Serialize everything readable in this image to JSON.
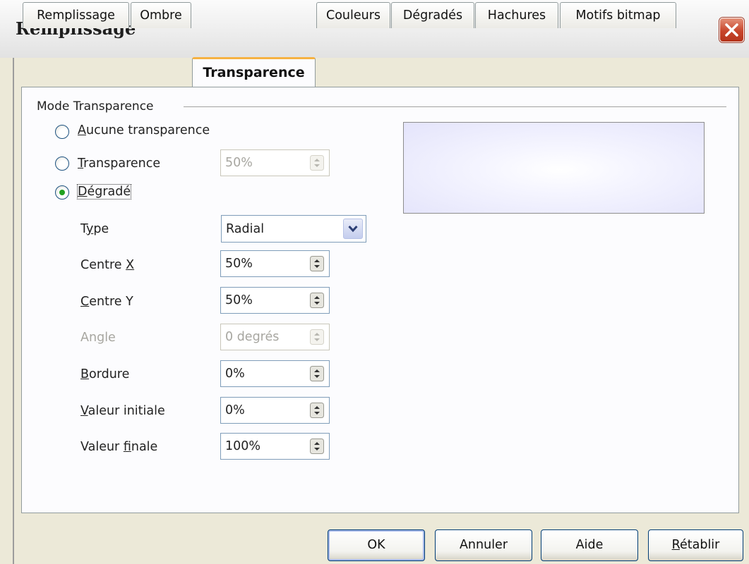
{
  "window": {
    "title": "Remplissage"
  },
  "tabs": [
    {
      "label": "Remplissage",
      "active": false
    },
    {
      "label": "Ombre",
      "active": false
    },
    {
      "label": "Transparence",
      "active": true
    },
    {
      "label": "Couleurs",
      "active": false
    },
    {
      "label": "Dégradés",
      "active": false
    },
    {
      "label": "Hachures",
      "active": false
    },
    {
      "label": "Motifs bitmap",
      "active": false
    }
  ],
  "group": {
    "label": "Mode Transparence"
  },
  "modes": {
    "none": {
      "label_u": "A",
      "label_rest": "ucune transparence",
      "selected": false
    },
    "transparency": {
      "label_u": "T",
      "label_rest": "ransparence",
      "selected": false,
      "value": "50%"
    },
    "gradient": {
      "label_u": "D",
      "label_rest": "égradé",
      "selected": true
    }
  },
  "gradient": {
    "type": {
      "label_pre": "T",
      "label_u": "y",
      "label_post": "pe",
      "value": "Radial"
    },
    "center_x": {
      "label_pre": "Centre ",
      "label_u": "X",
      "label_post": "",
      "value": "50%"
    },
    "center_y": {
      "label_pre": "",
      "label_u": "C",
      "label_post": "entre Y",
      "value": "50%"
    },
    "angle": {
      "label_pre": "An",
      "label_u": "g",
      "label_post": "le",
      "value": "0 degrés",
      "disabled": true
    },
    "border": {
      "label_pre": "",
      "label_u": "B",
      "label_post": "ordure",
      "value": "0%"
    },
    "start_value": {
      "label_pre": "",
      "label_u": "V",
      "label_post": "aleur initiale",
      "value": "0%"
    },
    "end_value": {
      "label_pre": "Valeur ",
      "label_u": "f",
      "label_post": "inale",
      "value": "100%"
    }
  },
  "buttons": {
    "ok": "OK",
    "cancel": "Annuler",
    "help": "Aide",
    "reset_u": "R",
    "reset_rest": "établir"
  },
  "colors": {
    "accent_tab": "#f6b242",
    "radio_selected": "#21a121",
    "field_border": "#7f9db9"
  }
}
